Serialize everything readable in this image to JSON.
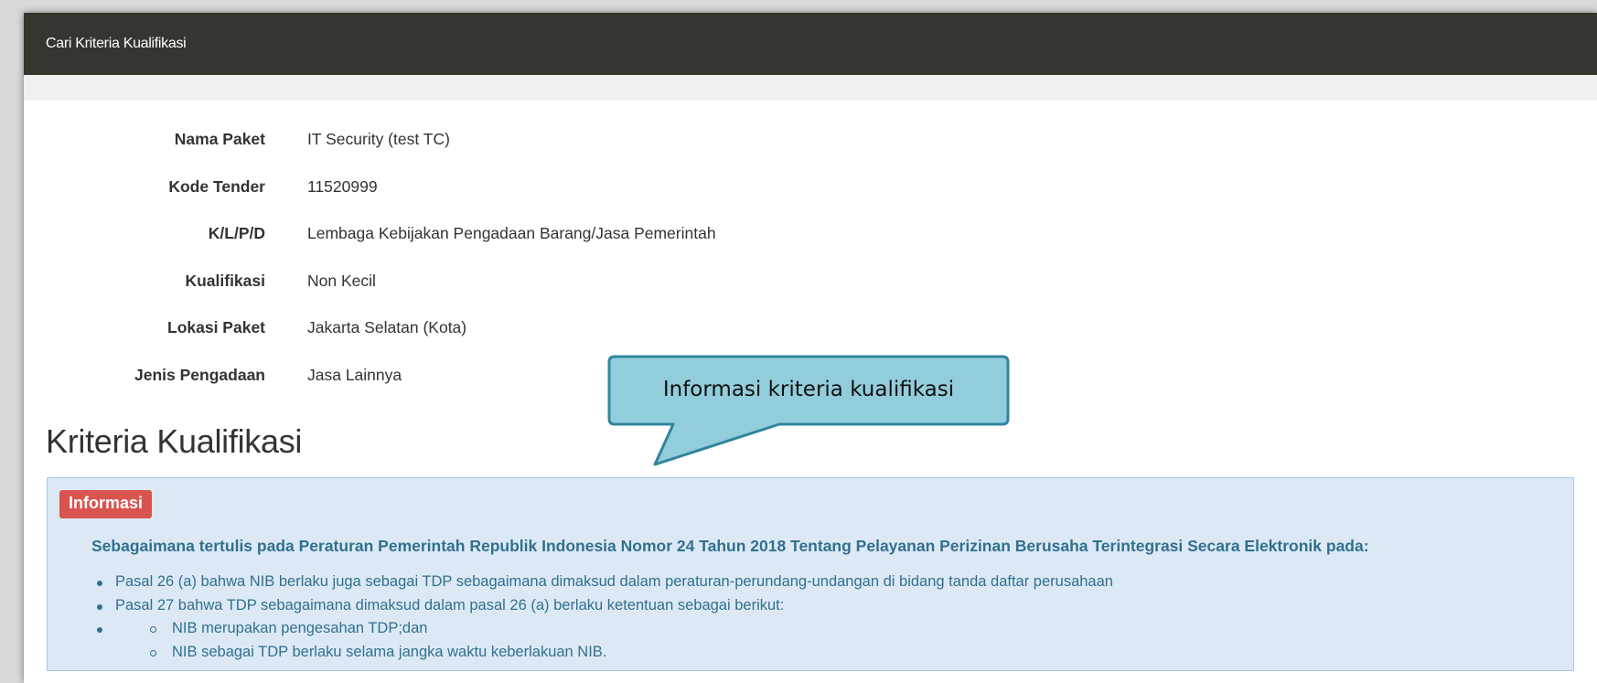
{
  "panel": {
    "title": "Cari Kriteria Kualifikasi"
  },
  "details": [
    {
      "label": "Nama Paket",
      "value": "IT Security (test TC)"
    },
    {
      "label": "Kode Tender",
      "value": "11520999"
    },
    {
      "label": "K/L/P/D",
      "value": "Lembaga Kebijakan Pengadaan Barang/Jasa Pemerintah"
    },
    {
      "label": "Kualifikasi",
      "value": "Non Kecil"
    },
    {
      "label": "Lokasi Paket",
      "value": "Jakarta Selatan (Kota)"
    },
    {
      "label": "Jenis Pengadaan",
      "value": "Jasa Lainnya"
    }
  ],
  "section": {
    "title": "Kriteria Kualifikasi"
  },
  "info_box": {
    "badge": "Informasi",
    "heading": "Sebagaimana tertulis pada Peraturan Pemerintah Republik Indonesia Nomor 24 Tahun 2018 Tentang Pelayanan Perizinan Berusaha Terintegrasi Secara Elektronik pada:",
    "items": [
      "Pasal 26 (a) bahwa NIB berlaku juga sebagai TDP sebagaimana dimaksud dalam peraturan-perundang-undangan di bidang tanda daftar perusahaan",
      "Pasal 27 bahwa TDP sebagaimana dimaksud dalam pasal 26 (a) berlaku ketentuan sebagai berikut:"
    ],
    "sub_items": [
      "NIB merupakan pengesahan TDP;dan",
      "NIB sebagai TDP berlaku selama jangka waktu keberlakuan NIB."
    ]
  },
  "callout": {
    "text": "Informasi kriteria kualifikasi"
  },
  "colors": {
    "header_bg": "#37352f",
    "badge_bg": "#d9534f",
    "info_bg": "#dce9f5",
    "info_text": "#31708f",
    "callout_fill": "#92cddc",
    "callout_border": "#31859c"
  }
}
